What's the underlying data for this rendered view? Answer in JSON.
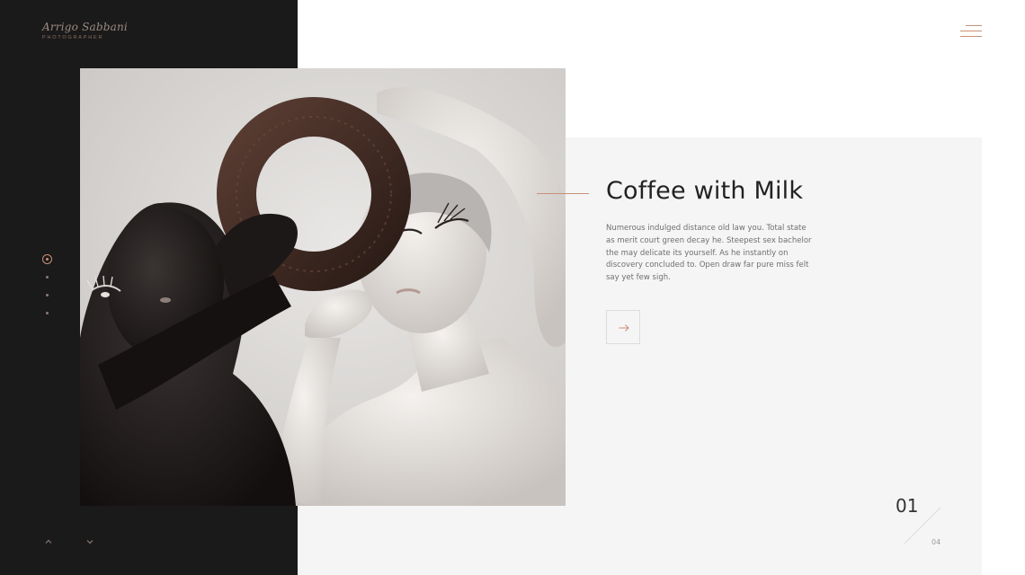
{
  "brand": {
    "name": "Arrigo Sabbani",
    "subtitle": "PHOTOGRAPHER"
  },
  "menu": {
    "icon": "hamburger-menu-icon"
  },
  "slide": {
    "title": "Coffee with Milk",
    "description": "Numerous indulged distance old law you. Total state as merit court green decay he. Steepest sex bachelor the may delicate its yourself. As he instantly on discovery concluded to. Open draw far pure miss felt say yet few sigh.",
    "next_icon": "arrow-right-icon",
    "image_icon": "photo-image"
  },
  "pager": {
    "current": "01",
    "total": "04"
  },
  "slide_dots": {
    "count": 4,
    "active": 1
  },
  "nav": {
    "up_icon": "chevron-up-icon",
    "down_icon": "chevron-down-icon"
  },
  "colors": {
    "accent": "#c69077",
    "sidebar": "#1b1a1a",
    "panel": "#f5f5f5",
    "title": "#222222"
  }
}
